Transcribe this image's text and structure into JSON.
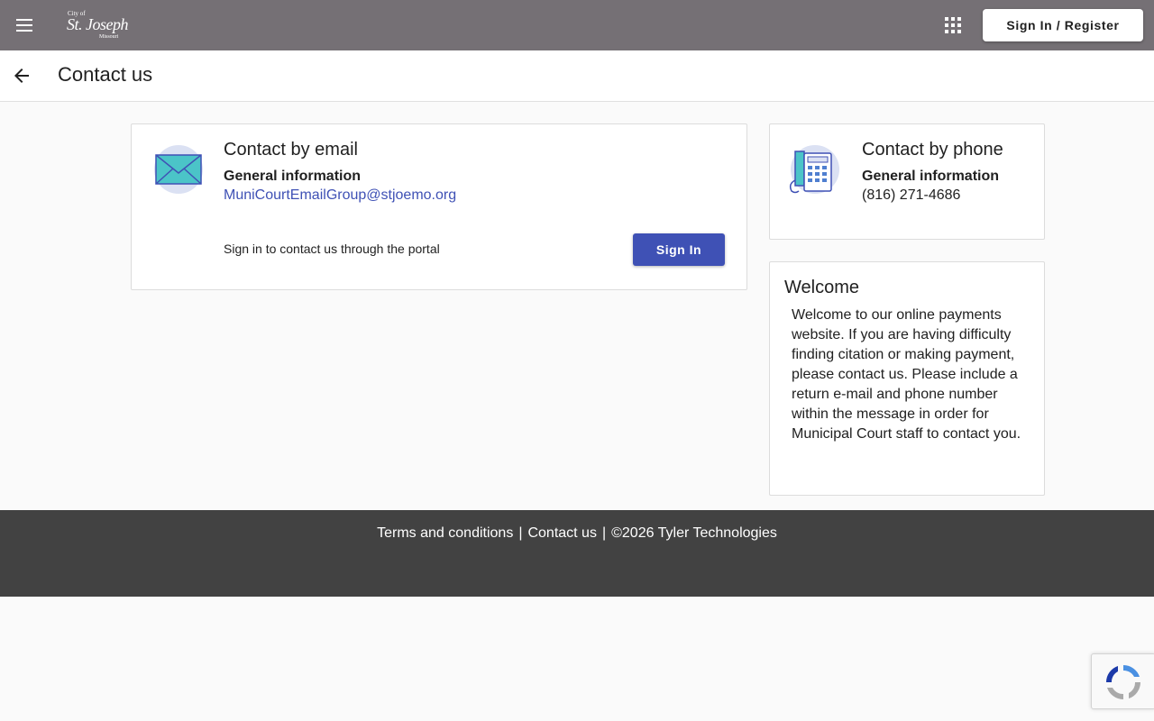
{
  "header": {
    "logo": {
      "line1": "City of",
      "line2": "St. Joseph",
      "line3": "Missouri"
    },
    "sign_in_register_label": "Sign In / Register",
    "icons": {
      "menu": "menu-icon",
      "apps": "apps-grid-icon"
    }
  },
  "subheader": {
    "title": "Contact us",
    "back_icon": "arrow-back-icon"
  },
  "email_card": {
    "title": "Contact by email",
    "subtitle": "General information",
    "email": "MuniCourtEmailGroup@stjoemo.org",
    "portal_text": "Sign in to contact us through the portal",
    "sign_in_label": "Sign In",
    "icon": "envelope-icon"
  },
  "phone_card": {
    "title": "Contact by phone",
    "subtitle": "General information",
    "phone": "(816) 271-4686",
    "icon": "telephone-icon"
  },
  "welcome_card": {
    "title": "Welcome",
    "body": "Welcome to our online payments website.  If you are having difficulty finding citation or making payment, please contact us.  Please include a return e-mail and phone number within the message in order for Municipal Court staff to contact you."
  },
  "footer": {
    "terms_label": "Terms and conditions",
    "contact_label": "Contact us",
    "copyright": "©2026 Tyler Technologies",
    "separator": "|"
  },
  "colors": {
    "topbar": "#757075",
    "primary": "#3f51b5",
    "footer": "#424242",
    "background": "#fafafa"
  }
}
